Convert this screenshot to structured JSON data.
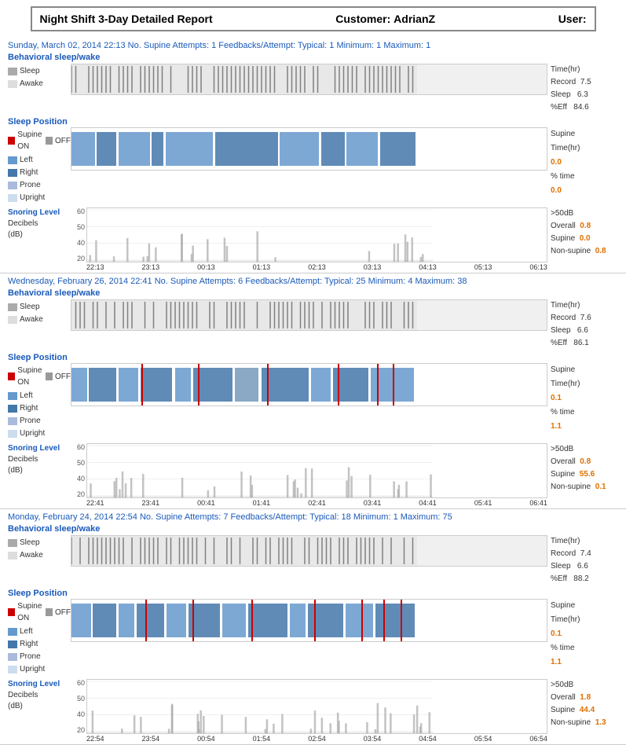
{
  "header": {
    "title": "Night Shift 3-Day Detailed Report",
    "customer_label": "Customer:",
    "customer_value": "AdrianZ",
    "user_label": "User:",
    "user_value": ""
  },
  "sessions": [
    {
      "date_line": "Sunday, March 02, 2014 22:13    No. Supine Attempts: 1    Feedbacks/Attempt: Typical: 1  Minimum: 1  Maximum: 1",
      "sleep_wake_label": "Behavioral sleep/wake",
      "sleep_label": "Sleep",
      "awake_label": "Awake",
      "stats_sleep": {
        "time_hr_label": "Time(hr)",
        "record": "7.5",
        "sleep": "6.3",
        "pct_eff": "84.6"
      },
      "position_label": "Sleep Position",
      "supine_on": "Supine ON",
      "supine_off": "OFF",
      "left_label": "Left",
      "right_label": "Right",
      "prone_label": "Prone",
      "upright_label": "Upright",
      "stats_position": {
        "supine_label": "Supine",
        "time_hr_label": "Time(hr)",
        "time_val": "0.0",
        "pct_time_label": "% time",
        "pct_val": "0.0"
      },
      "snoring_label": "Snoring Level",
      "decibels_label": "Decibels",
      "db_label": "(dB)",
      "stats_snoring": {
        "gt50_label": ">50dB",
        "overall_label": "Overall",
        "overall_val": "0.8",
        "supine_label": "Supine",
        "supine_val": "0.0",
        "nonsupine_label": "Non-supine",
        "nonsupine_val": "0.8"
      },
      "xaxis": [
        "22:13",
        "23:13",
        "00:13",
        "01:13",
        "02:13",
        "03:13",
        "04:13",
        "05:13",
        "06:13"
      ]
    },
    {
      "date_line": "Wednesday, February 26, 2014 22:41  No. Supine Attempts: 6  Feedbacks/Attempt: Typical: 25  Minimum: 4  Maximum: 38",
      "sleep_wake_label": "Behavioral sleep/wake",
      "sleep_label": "Sleep",
      "awake_label": "Awake",
      "stats_sleep": {
        "time_hr_label": "Time(hr)",
        "record": "7.6",
        "sleep": "6.6",
        "pct_eff": "86.1"
      },
      "position_label": "Sleep Position",
      "supine_on": "Supine ON",
      "supine_off": "OFF",
      "left_label": "Left",
      "right_label": "Right",
      "prone_label": "Prone",
      "upright_label": "Upright",
      "stats_position": {
        "supine_label": "Supine",
        "time_hr_label": "Time(hr)",
        "time_val": "0.1",
        "pct_time_label": "% time",
        "pct_val": "1.1"
      },
      "snoring_label": "Snoring Level",
      "decibels_label": "Decibels",
      "db_label": "(dB)",
      "stats_snoring": {
        "gt50_label": ">50dB",
        "overall_label": "Overall",
        "overall_val": "0.8",
        "supine_label": "Supine",
        "supine_val": "55.6",
        "nonsupine_label": "Non-supine",
        "nonsupine_val": "0.1"
      },
      "xaxis": [
        "22:41",
        "23:41",
        "00:41",
        "01:41",
        "02:41",
        "03:41",
        "04:41",
        "05:41",
        "06:41"
      ]
    },
    {
      "date_line": "Monday, February 24, 2014 22:54  No. Supine Attempts: 7  Feedbacks/Attempt: Typical: 18  Minimum: 1  Maximum: 75",
      "sleep_wake_label": "Behavioral sleep/wake",
      "sleep_label": "Sleep",
      "awake_label": "Awake",
      "stats_sleep": {
        "time_hr_label": "Time(hr)",
        "record": "7.4",
        "sleep": "6.6",
        "pct_eff": "88.2"
      },
      "position_label": "Sleep Position",
      "supine_on": "Supine ON",
      "supine_off": "OFF",
      "left_label": "Left",
      "right_label": "Right",
      "prone_label": "Prone",
      "upright_label": "Upright",
      "stats_position": {
        "supine_label": "Supine",
        "time_hr_label": "Time(hr)",
        "time_val": "0.1",
        "pct_time_label": "% time",
        "pct_val": "1.1"
      },
      "snoring_label": "Snoring Level",
      "decibels_label": "Decibels",
      "db_label": "(dB)",
      "stats_snoring": {
        "gt50_label": ">50dB",
        "overall_label": "Overall",
        "overall_val": "1.8",
        "supine_label": "Supine",
        "supine_val": "44.4",
        "nonsupine_label": "Non-supine",
        "nonsupine_val": "1.3"
      },
      "xaxis": [
        "22:54",
        "23:54",
        "00:54",
        "01:54",
        "02:54",
        "03:54",
        "04:54",
        "05:54",
        "06:54"
      ]
    }
  ]
}
